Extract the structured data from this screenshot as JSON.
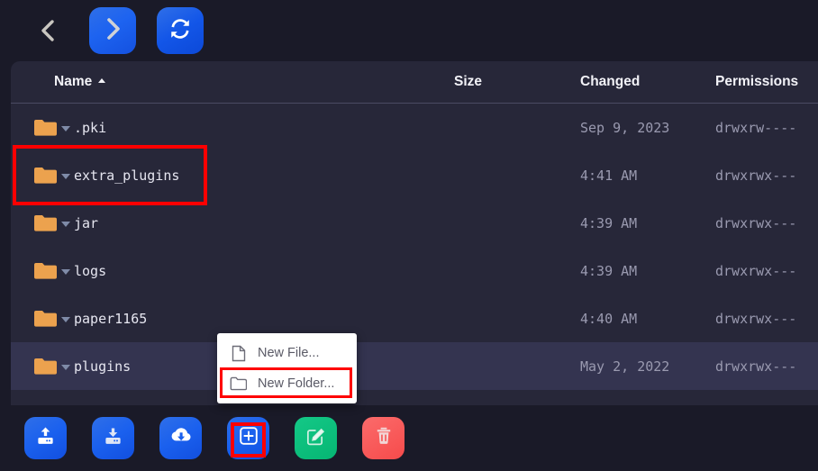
{
  "toolbar_top": {
    "back": {
      "label": "Back",
      "icon": "chevron-left-icon"
    },
    "forward": {
      "label": "Forward",
      "icon": "chevron-right-icon"
    },
    "refresh": {
      "label": "Refresh",
      "icon": "refresh-icon"
    }
  },
  "file_list": {
    "columns": [
      {
        "key": "name",
        "label": "Name",
        "sorted": "asc"
      },
      {
        "key": "size",
        "label": "Size"
      },
      {
        "key": "changed",
        "label": "Changed"
      },
      {
        "key": "permissions",
        "label": "Permissions"
      }
    ],
    "rows": [
      {
        "name": ".pki",
        "size": "",
        "changed": "Sep 9, 2023",
        "permissions": "drwxrw----",
        "type": "folder",
        "selected": false
      },
      {
        "name": "extra_plugins",
        "size": "",
        "changed": "4:41 AM",
        "permissions": "drwxrwx---",
        "type": "folder",
        "selected": false
      },
      {
        "name": "jar",
        "size": "",
        "changed": "4:39 AM",
        "permissions": "drwxrwx---",
        "type": "folder",
        "selected": false
      },
      {
        "name": "logs",
        "size": "",
        "changed": "4:39 AM",
        "permissions": "drwxrwx---",
        "type": "folder",
        "selected": false
      },
      {
        "name": "paper1165",
        "size": "",
        "changed": "4:40 AM",
        "permissions": "drwxrwx---",
        "type": "folder",
        "selected": false
      },
      {
        "name": "plugins",
        "size": "",
        "changed": "May 2, 2022",
        "permissions": "drwxrwx---",
        "type": "folder",
        "selected": true
      },
      {
        "name": "",
        "size": "",
        "changed": "",
        "permissions": "",
        "type": "folder",
        "selected": false
      }
    ]
  },
  "context_menu": {
    "items": [
      {
        "label": "New File...",
        "icon": "file-outline-icon"
      },
      {
        "label": "New Folder...",
        "icon": "folder-outline-icon"
      }
    ]
  },
  "toolbar_bottom": {
    "buttons": [
      {
        "label": "Upload",
        "icon": "upload-icon",
        "color": "#1a60ee"
      },
      {
        "label": "Download",
        "icon": "download-icon",
        "color": "#1a60ee"
      },
      {
        "label": "Cloud Download",
        "icon": "cloud-download-icon",
        "color": "#1a60ee"
      },
      {
        "label": "New",
        "icon": "add-box-icon",
        "color": "#1a60ee"
      },
      {
        "label": "Edit",
        "icon": "edit-square-icon",
        "color": "#06b673"
      },
      {
        "label": "Delete",
        "icon": "trash-icon",
        "color": "#f64b4b"
      }
    ]
  },
  "annotations": {
    "color": "#fe0000",
    "boxes": [
      {
        "target": "extra_plugins row"
      },
      {
        "target": "New Folder... menu item"
      },
      {
        "target": "New (add-box) toolbar button"
      }
    ]
  },
  "colors": {
    "page_background": "#1a1a28",
    "panel_background": "#272739",
    "selected_row": "#343450",
    "folder_icon": "#eca24e",
    "accent_blue": "#1a60ee",
    "accent_green": "#06b673",
    "accent_red": "#f64b4b",
    "annotation_red": "#fe0000"
  }
}
